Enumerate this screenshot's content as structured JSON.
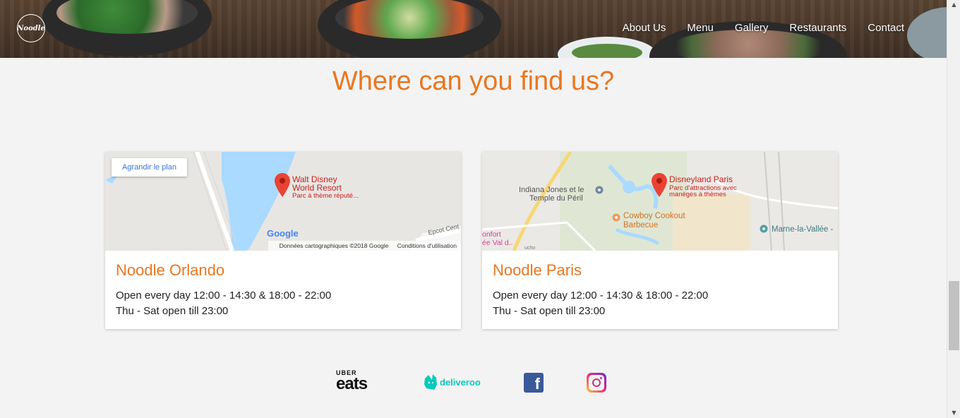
{
  "header": {
    "logo_text": "Noodle",
    "nav": [
      "About Us",
      "Menu",
      "Gallery",
      "Restaurants",
      "Contact"
    ]
  },
  "section_title": "Where can you find us?",
  "restaurants": [
    {
      "name": "Noodle Orlando",
      "hours_line1": "Open every day 12:00 - 14:30 & 18:00 - 22:00",
      "hours_line2": "Thu - Sat open till 23:00",
      "map": {
        "enlarge_label": "Agrandir le plan",
        "place_name_1": "Walt Disney",
        "place_name_2": "World Resort",
        "place_sub": "Parc à thème réputé...",
        "road_label": "Epcot Cent",
        "google": "Google",
        "attrib_data": "Données cartographiques ©2018 Google",
        "attrib_terms": "Conditions d'utilisation"
      }
    },
    {
      "name": "Noodle Paris",
      "hours_line1": "Open every day 12:00 - 14:30 & 18:00 - 22:00",
      "hours_line2": "Thu - Sat open till 23:00",
      "map": {
        "place_name": "Disneyland Paris",
        "place_sub_1": "Parc d'attractions avec",
        "place_sub_2": "manèges à thèmes",
        "poi_1_line1": "Indiana Jones et le",
        "poi_1_line2": "Temple du Péril",
        "poi_2_line1": "Cowboy Cookout",
        "poi_2_line2": "Barbecue",
        "poi_3": "Marne-la-Vallée -",
        "edge_1": "onfort",
        "edge_2": "ée Val d..",
        "edge_3": "ucho"
      }
    }
  ],
  "social": {
    "uber_top": "UBER",
    "uber_bottom": "eats",
    "deliveroo": "deliveroo",
    "facebook": "f"
  },
  "colors": {
    "accent": "#e87722",
    "background": "#f3f3f3",
    "deliveroo": "#00ccbc",
    "facebook": "#3b5998"
  }
}
